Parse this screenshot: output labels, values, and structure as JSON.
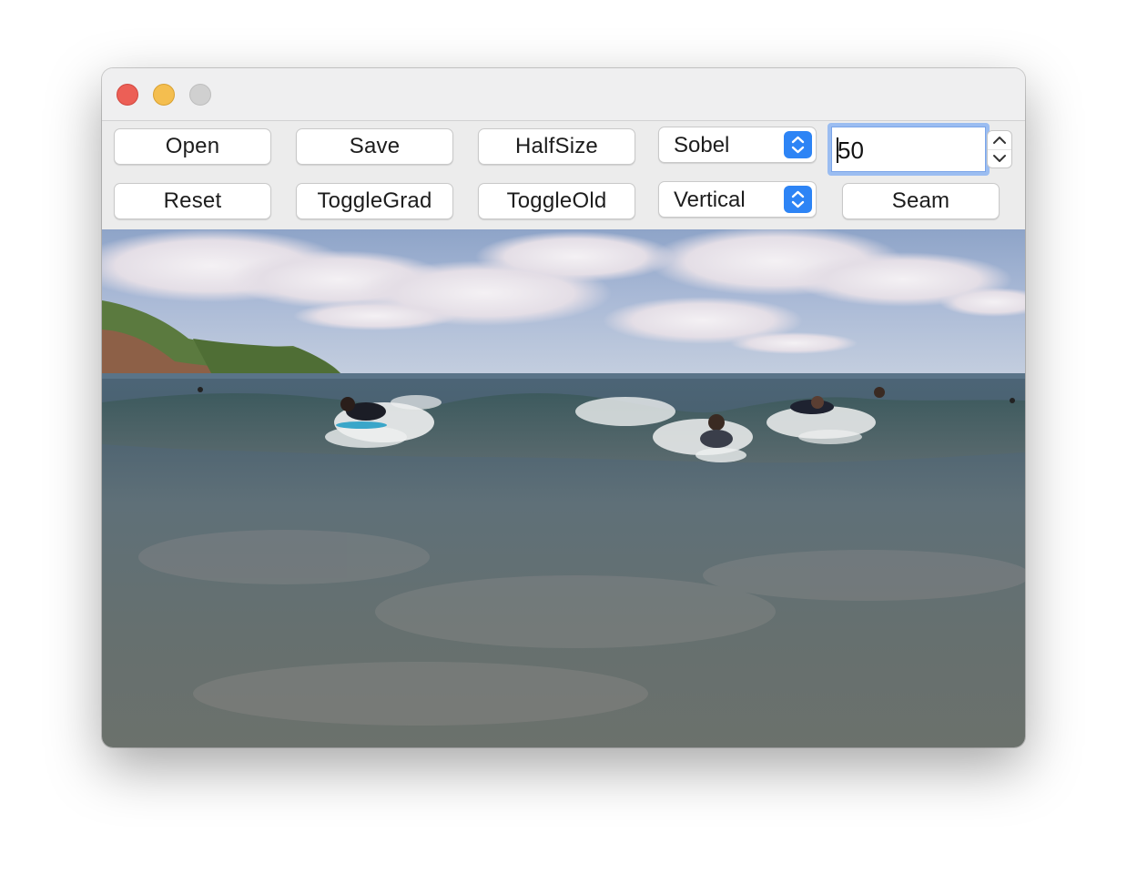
{
  "window": {
    "traffic_lights": [
      "close-button",
      "minimize-button",
      "zoom-button"
    ]
  },
  "toolbar": {
    "open_label": "Open",
    "save_label": "Save",
    "halfsize_label": "HalfSize",
    "gradient_select_value": "Sobel",
    "seam_count_value": "50",
    "reset_label": "Reset",
    "togglegrad_label": "ToggleGrad",
    "toggleold_label": "ToggleOld",
    "direction_select_value": "Vertical",
    "seam_label": "Seam"
  },
  "colors": {
    "accent": "#2d84f5",
    "focus_ring": "#9bbdf1",
    "close": "#ec5f56",
    "minimize": "#f4be4f",
    "zoom_inactive": "#d0d0d0"
  },
  "image_view": {
    "icon": "photo-beach-surfers"
  }
}
